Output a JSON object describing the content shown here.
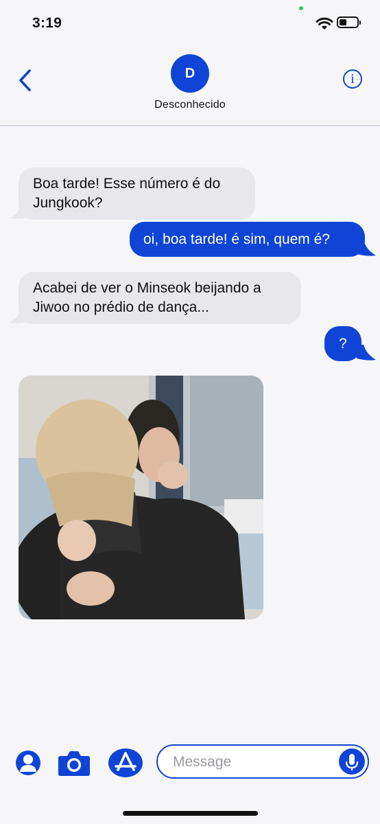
{
  "status_bar": {
    "time": "3:19"
  },
  "header": {
    "avatar_initial": "D",
    "contact_name": "Desconhecido",
    "info_symbol": "i"
  },
  "messages": [
    {
      "direction": "incoming",
      "text_line1": "Boa tarde! Esse número é do",
      "text_line2": "Jungkook?"
    },
    {
      "direction": "outgoing",
      "text": "oi, boa tarde! é sim, quem é?"
    },
    {
      "direction": "incoming",
      "text_line1": "Acabei de ver o Minseok beijando a",
      "text_line2": "Jiwoo no prédio de dança..."
    },
    {
      "direction": "outgoing",
      "text": "?"
    },
    {
      "direction": "incoming",
      "type": "photo"
    }
  ],
  "input": {
    "placeholder": "Message",
    "value": ""
  },
  "icons": {
    "back": "chevron-left-icon",
    "info": "info-icon",
    "contact": "contact-icon",
    "camera": "camera-icon",
    "appstore": "app-store-icon",
    "mic": "microphone-icon"
  },
  "colors": {
    "accent": "#0f44d6",
    "incoming_bubble": "#e7e7ec",
    "background": "#f6f6f8"
  }
}
